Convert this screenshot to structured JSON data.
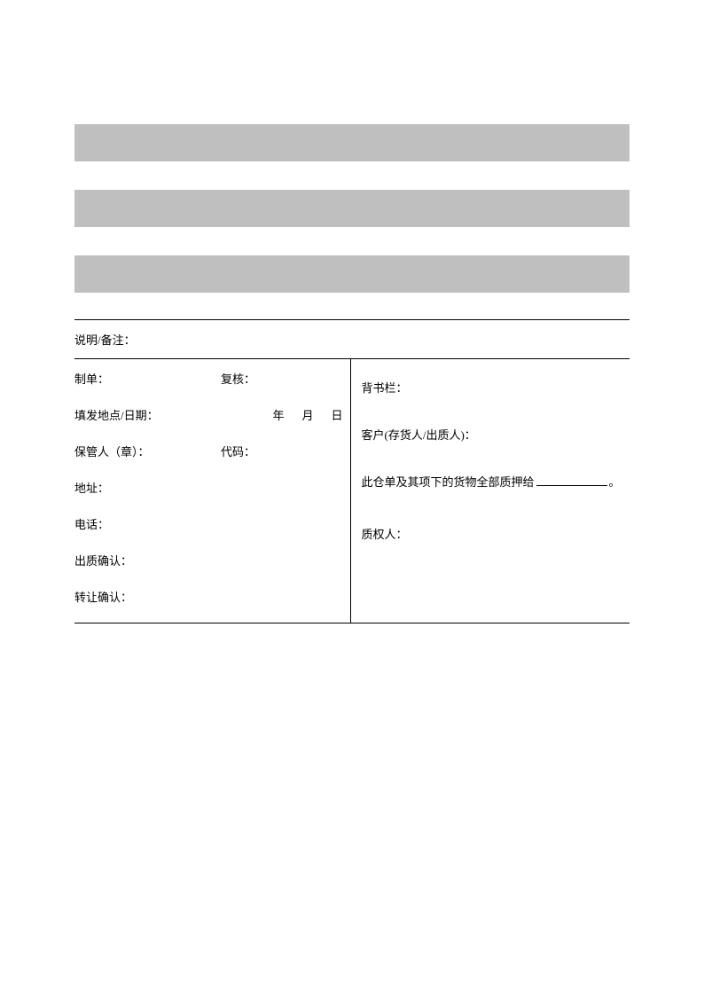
{
  "graybars": [
    "",
    "",
    ""
  ],
  "remarks": {
    "label": "说明/备注："
  },
  "left": {
    "preparer_label": "制单：",
    "reviewer_label": "复核：",
    "issue_place_date_label": "填发地点/日期：",
    "year": "年",
    "month": "月",
    "day": "日",
    "custodian_label": "保管人（章）：",
    "code_label": "代码：",
    "address_label": "地址：",
    "phone_label": "电话：",
    "pledge_confirm_label": "出质确认：",
    "transfer_confirm_label": "转让确认："
  },
  "right": {
    "endorsement_label": "背书栏：",
    "client_label": "客户(存货人/出质人)：",
    "pledge_text_before": "此仓单及其项下的货物全部质押给",
    "pledge_text_after": "。",
    "pledgee_label": "质权人："
  }
}
